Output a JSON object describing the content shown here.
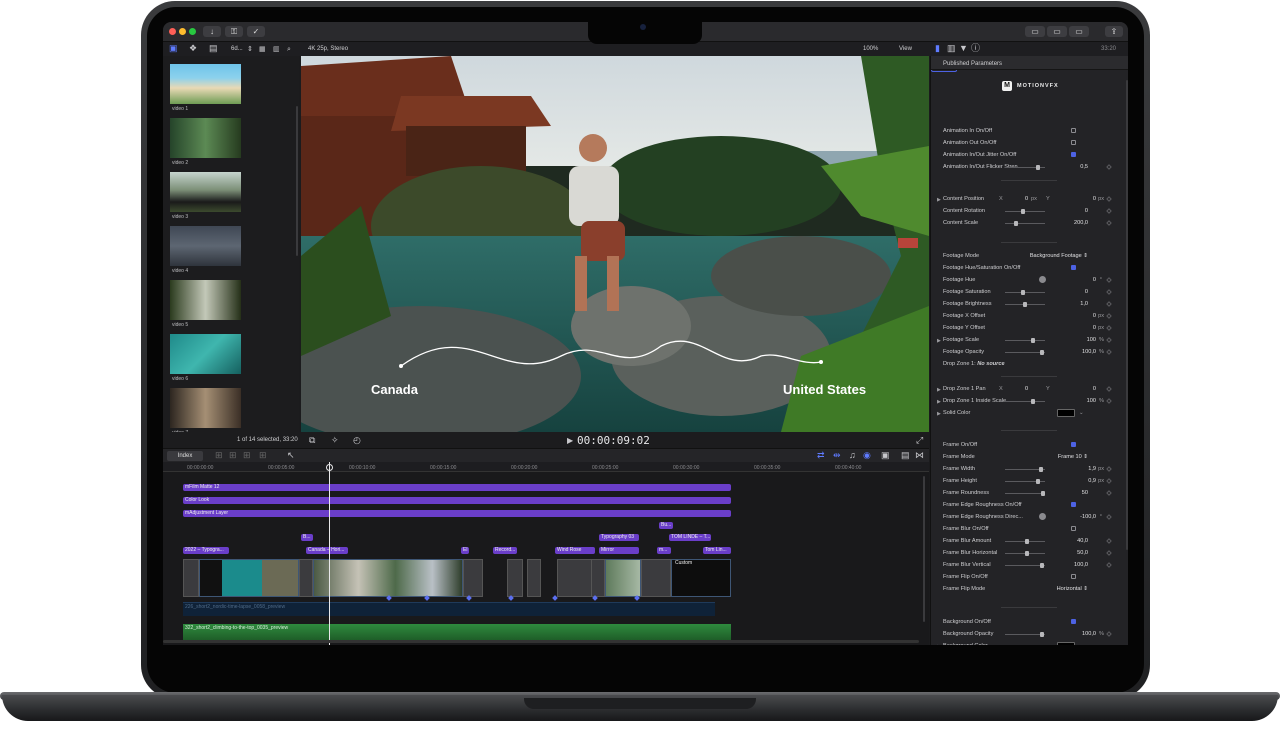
{
  "window": {
    "title": "4K 25p, Stereo",
    "zoom": "100%",
    "view_label": "View",
    "timecode": "33:20",
    "library_label": "6d..."
  },
  "browser": {
    "items": [
      {
        "label": "video 1"
      },
      {
        "label": "video 2"
      },
      {
        "label": "video 3"
      },
      {
        "label": "video 4"
      },
      {
        "label": "video 5"
      },
      {
        "label": "video 6"
      },
      {
        "label": "video 7"
      }
    ],
    "status": "1 of 14 selected, 33:20"
  },
  "viewer": {
    "title_left": "Canada",
    "title_right": "United States",
    "play_timecode": "00:00:09:02"
  },
  "inspector": {
    "header": "Published Parameters",
    "brand": "MOTIONVFX",
    "rows": [
      {
        "label": "Animation In On/Off",
        "type": "check",
        "on": false
      },
      {
        "label": "Animation Out On/Off",
        "type": "check",
        "on": false
      },
      {
        "label": "Animation In/Out Jitter On/Off",
        "type": "check",
        "on": true
      },
      {
        "label": "Animation In/Out Flicker Stren...",
        "type": "slider",
        "value": "0,5"
      },
      {
        "label": "Content Position",
        "type": "xy",
        "x_label": "X",
        "x": "0",
        "x_unit": "px",
        "y_label": "Y",
        "y": "0",
        "y_unit": "px"
      },
      {
        "label": "Content Rotation",
        "type": "slider",
        "value": "0"
      },
      {
        "label": "Content Scale",
        "type": "slider",
        "value": "200,0"
      },
      {
        "label": "Footage Mode",
        "type": "popup",
        "value": "Background Footage"
      },
      {
        "label": "Footage Hue/Saturation On/Off",
        "type": "check",
        "on": true
      },
      {
        "label": "Footage Hue",
        "type": "dial",
        "value": "0",
        "unit": "°"
      },
      {
        "label": "Footage Saturation",
        "type": "slider",
        "value": "0"
      },
      {
        "label": "Footage Brightness",
        "type": "slider",
        "value": "1,0"
      },
      {
        "label": "Footage X Offset",
        "type": "value",
        "value": "0",
        "unit": "px"
      },
      {
        "label": "Footage Y Offset",
        "type": "value",
        "value": "0",
        "unit": "px"
      },
      {
        "label": "Footage Scale",
        "type": "slider",
        "value": "100",
        "unit": "%"
      },
      {
        "label": "Footage Opacity",
        "type": "slider",
        "value": "100,0",
        "unit": "%"
      },
      {
        "label": "Drop Zone 1:",
        "type": "dropzone",
        "value": "No source"
      },
      {
        "label": "Drop Zone 1 Pan",
        "type": "xy",
        "x_label": "X",
        "x": "0",
        "x_unit": "",
        "y_label": "Y",
        "y": "0",
        "y_unit": ""
      },
      {
        "label": "Drop Zone 1 Inside Scale",
        "type": "slider",
        "value": "100",
        "unit": "%"
      },
      {
        "label": "Solid Color",
        "type": "color"
      },
      {
        "label": "Frame On/Off",
        "type": "check",
        "on": true
      },
      {
        "label": "Frame Mode",
        "type": "popup",
        "value": "Frame 10"
      },
      {
        "label": "Frame Width",
        "type": "slider",
        "value": "1,9",
        "unit": "px"
      },
      {
        "label": "Frame Height",
        "type": "slider",
        "value": "0,9",
        "unit": "px"
      },
      {
        "label": "Frame Roundness",
        "type": "slider",
        "value": "50"
      },
      {
        "label": "Frame Edge Roughness On/Off",
        "type": "check",
        "on": true
      },
      {
        "label": "Frame Edge Roughness Direc...",
        "type": "dial",
        "value": "-100,0",
        "unit": "°"
      },
      {
        "label": "Frame Blur On/Off",
        "type": "check",
        "on": false
      },
      {
        "label": "Frame Blur Amount",
        "type": "slider",
        "value": "40,0"
      },
      {
        "label": "Frame Blur Horizontal",
        "type": "slider",
        "value": "50,0"
      },
      {
        "label": "Frame Blur Vertical",
        "type": "slider",
        "value": "100,0"
      },
      {
        "label": "Frame Flip On/Off",
        "type": "check",
        "on": false
      },
      {
        "label": "Frame Flip Mode",
        "type": "popup",
        "value": "Horizontal"
      },
      {
        "label": "Background On/Off",
        "type": "check",
        "on": true
      },
      {
        "label": "Background Opacity",
        "type": "slider",
        "value": "100,0",
        "unit": "%"
      },
      {
        "label": "Background Color",
        "type": "color"
      }
    ]
  },
  "timeline": {
    "index_label": "Index",
    "ruler": [
      "00:00:00:00",
      "00:00:05:00",
      "00:00:10:00",
      "00:00:15:00",
      "00:00:20:00",
      "00:00:25:00",
      "00:00:30:00",
      "00:00:35:00",
      "00:00:40:00"
    ],
    "lanes": [
      {
        "label": "mFilm Matte 12"
      },
      {
        "label": "Color Look"
      },
      {
        "label": "mAdjustment Layer"
      }
    ],
    "titles": [
      {
        "label": "2022 – Typogra..."
      },
      {
        "label": "B..."
      },
      {
        "label": "Canada – Hori..."
      },
      {
        "label": "El"
      },
      {
        "label": "Record..."
      },
      {
        "label": "Wind Rose"
      },
      {
        "label": "Mirror"
      },
      {
        "label": "Typography 03"
      },
      {
        "label": "Bu..."
      },
      {
        "label": "m..."
      },
      {
        "label": "TOM LINDE – T..."
      },
      {
        "label": "Tom Lin..."
      }
    ],
    "custom_label": "Custom",
    "audio1": "226_short2_nordic-time-lapse_0058_preview",
    "audio2": "322_short2_climbing-to-the-top_0035_preview"
  }
}
